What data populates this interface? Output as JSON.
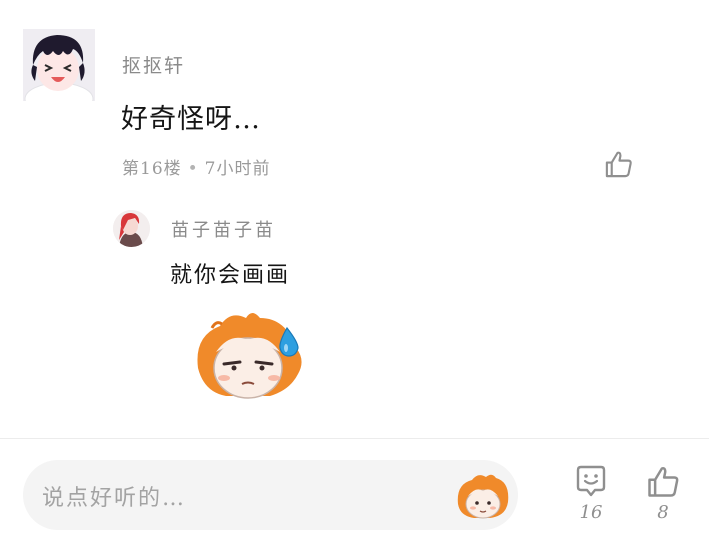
{
  "main_comment": {
    "username": "抠抠轩",
    "text": "好奇怪呀…",
    "floor": "第16楼",
    "separator": "•",
    "time": "7小时前"
  },
  "reply": {
    "username": "苗子苗子苗",
    "text": "就你会画画"
  },
  "bottom_bar": {
    "input_placeholder": "说点好听的…",
    "comment_count": "16",
    "like_count": "8"
  },
  "icons": {
    "like": "thumbs-up-icon",
    "comment": "smile-chat-bubble-icon",
    "emoji": "emoji-sticker-icon"
  },
  "colors": {
    "text_primary": "#151515",
    "text_secondary": "#8a8a8a",
    "icon": "#8f8f8f",
    "input_bg": "#f4f4f4",
    "sticker_orange": "#f08a2a"
  }
}
